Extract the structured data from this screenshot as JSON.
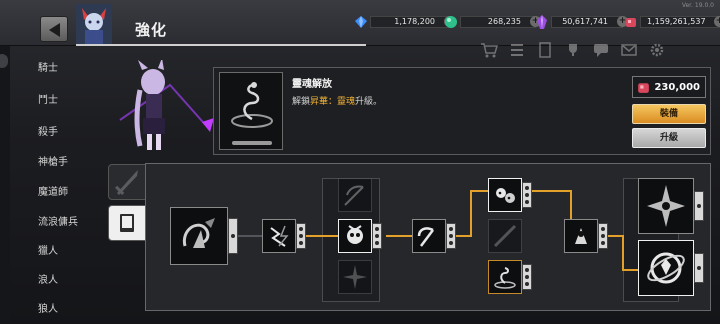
{
  "app": {
    "version": "Ver. 19.0.0",
    "title": "強化"
  },
  "currencies": [
    {
      "name": "diamond",
      "icon": "diamond-icon",
      "color": "#3d8eff",
      "value": "1,178,200"
    },
    {
      "name": "green-orb",
      "icon": "green-orb-icon",
      "color": "#2fbf8a",
      "value": "268,235"
    },
    {
      "name": "purple-crystal",
      "icon": "purple-crystal-icon",
      "color": "#9a4de0",
      "value": "50,617,741"
    },
    {
      "name": "red-gem",
      "icon": "red-gem-icon",
      "color": "#d8475b",
      "value": "1,159,261,537"
    }
  ],
  "classes": [
    "騎士",
    "鬥士",
    "殺手",
    "神槍手",
    "魔道師",
    "流浪傭兵",
    "獵人",
    "浪人",
    "狼人"
  ],
  "skill": {
    "name": "靈魂解放",
    "desc_prefix": "解鎖",
    "desc_highlight": "昇華：靈魂",
    "desc_suffix": "升級。",
    "cost": "230,000",
    "cost_icon": "red-gem-icon",
    "equip_label": "裝備",
    "upgrade_label": "升級"
  },
  "tabs": [
    {
      "name": "sword-tab",
      "icon": "sword-icon",
      "active": false
    },
    {
      "name": "book-tab",
      "icon": "book-icon",
      "active": true
    }
  ],
  "colors": {
    "accent": "#e3a02a",
    "highlight_text": "#f2b233",
    "equip_button": "#f0b040"
  }
}
